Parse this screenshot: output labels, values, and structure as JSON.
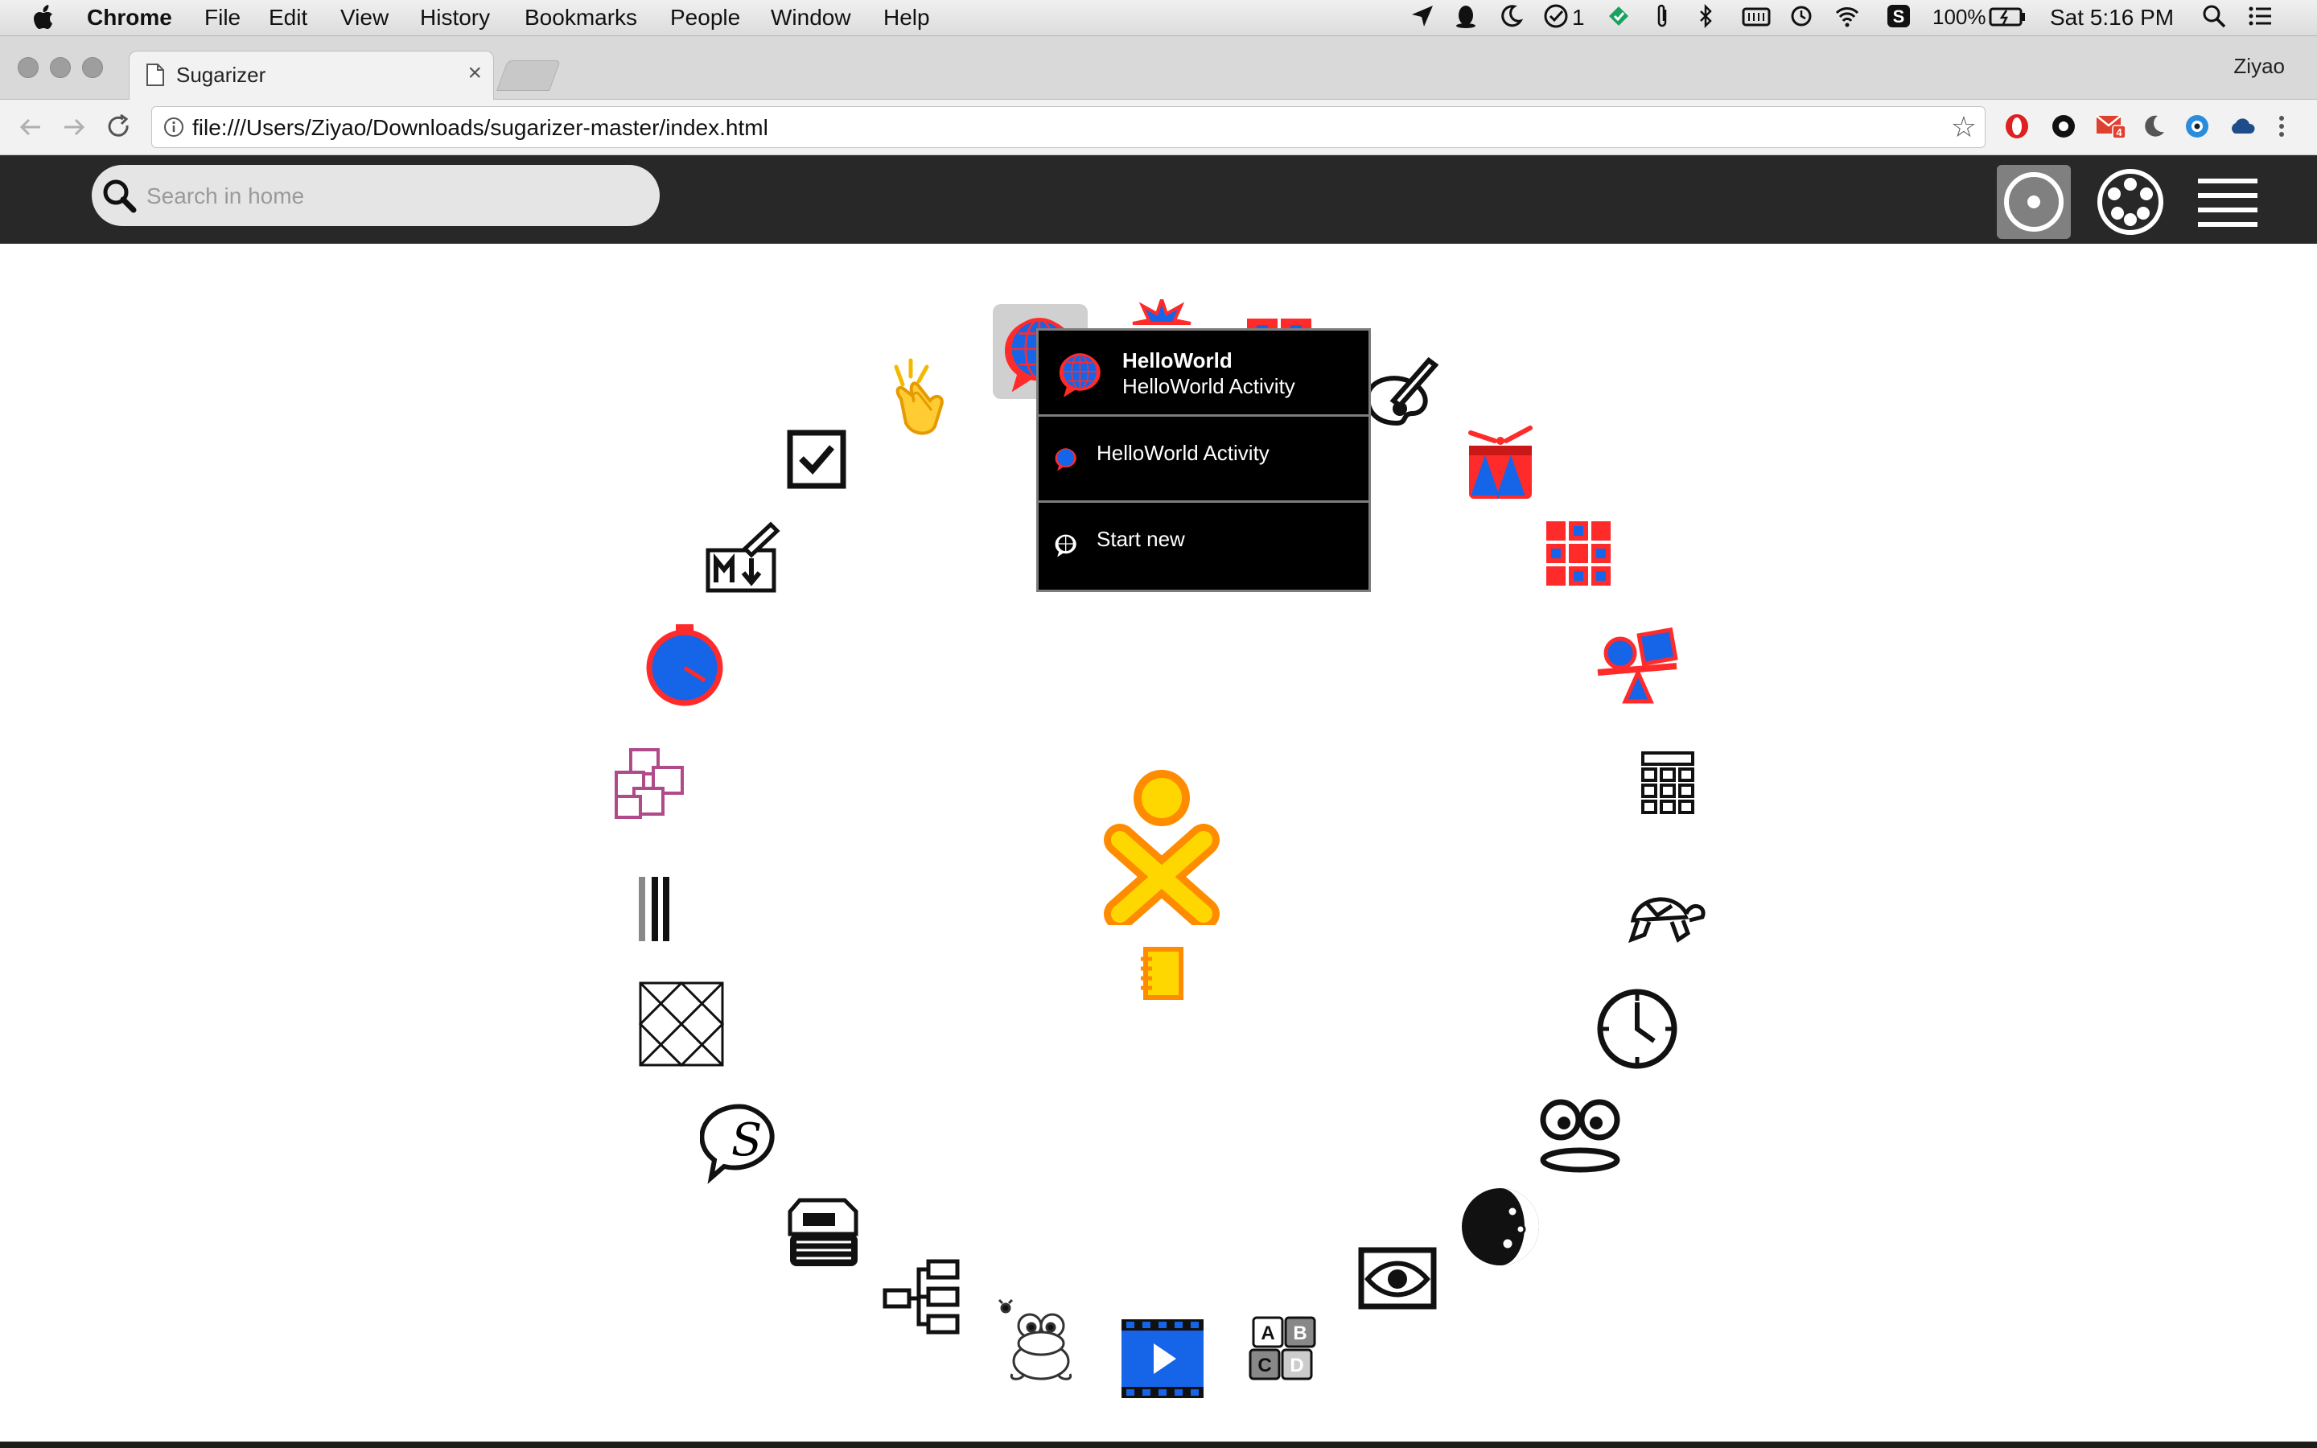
{
  "menubar": {
    "app": "Chrome",
    "items": [
      "File",
      "Edit",
      "View",
      "History",
      "Bookmarks",
      "People",
      "Window",
      "Help"
    ],
    "battery": "100%",
    "clock": "Sat 5:16 PM",
    "badge_count": "1"
  },
  "browser": {
    "tab_title": "Sugarizer",
    "tab_close": "×",
    "profile": "Ziyao",
    "url": "file:///Users/Ziyao/Downloads/sugarizer-master/index.html",
    "ext_badge": "4"
  },
  "sugar": {
    "search_placeholder": "Search in home"
  },
  "popup": {
    "title": "HelloWorld",
    "subtitle": "HelloWorld Activity",
    "item_activity": "HelloWorld Activity",
    "item_start": "Start new"
  },
  "colors": {
    "toolbar": "#282828",
    "xo_fill": "#ffd700",
    "xo_stroke": "#ff8c00",
    "activity_blue": "#1664e8",
    "activity_red": "#ff2b2b"
  },
  "icons": [
    "helloworld-icon",
    "clapping-hands-icon",
    "checkbox-icon",
    "markdown-icon",
    "stopwatch-icon",
    "sticky-notes-icon",
    "abacus-icon",
    "geometry-icon",
    "speech-s-icon",
    "printer-icon",
    "mindmap-icon",
    "frog-icon",
    "video-icon",
    "abcd-blocks-icon",
    "eye-icon",
    "moon-icon",
    "face-icon",
    "clock-icon",
    "turtle-icon",
    "calculator-icon",
    "seesaw-icon",
    "grid-game-icon",
    "drum-icon",
    "paint-icon",
    "xo-icon",
    "journal-icon"
  ]
}
